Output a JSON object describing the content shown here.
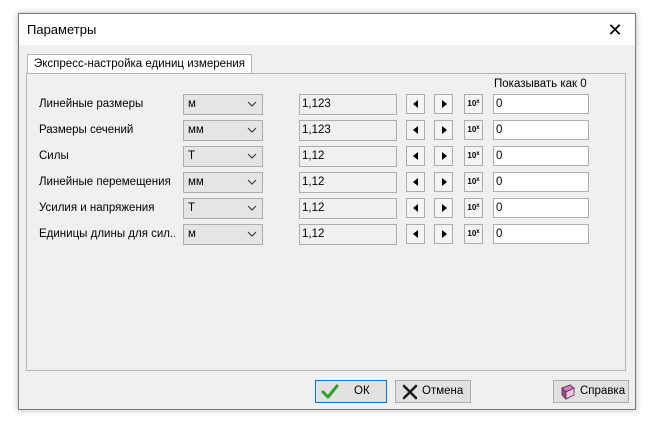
{
  "window": {
    "title": "Параметры"
  },
  "tab": {
    "label": "Экспресс-настройка единиц измерения"
  },
  "show_as_zero_label": "Показывать как 0",
  "rows": [
    {
      "label": "Линейные размеры",
      "unit": "м",
      "format": "1,123",
      "zero": "0"
    },
    {
      "label": "Размеры сечений",
      "unit": "мм",
      "format": "1,123",
      "zero": "0"
    },
    {
      "label": "Силы",
      "unit": "Т",
      "format": "1,12",
      "zero": "0"
    },
    {
      "label": "Линейные перемещения",
      "unit": "мм",
      "format": "1,12",
      "zero": "0"
    },
    {
      "label": "Усилия и напряжения",
      "unit": "Т",
      "format": "1,12",
      "zero": "0"
    },
    {
      "label": "Единицы длины для сил...",
      "unit": "м",
      "format": "1,12",
      "zero": "0"
    }
  ],
  "exp_button": {
    "base": "10",
    "power": "x"
  },
  "buttons": {
    "ok": "ОК",
    "cancel": "Отмена",
    "help": "Справка"
  },
  "colors": {
    "ok_check": "#2e9e2e",
    "cancel_x": "#1a1a1a",
    "focus_border": "#0078d7"
  }
}
